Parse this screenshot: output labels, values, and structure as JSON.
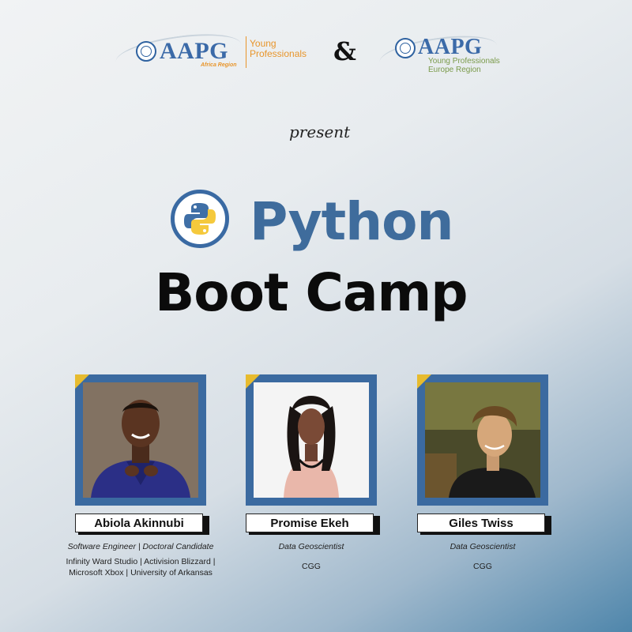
{
  "header": {
    "logo_left": {
      "brand": "AAPG",
      "region": "Africa Region",
      "program_line1": "Young",
      "program_line2": "Professionals"
    },
    "ampersand": "&",
    "logo_right": {
      "brand": "AAPG",
      "program_line1": "Young Professionals",
      "program_line2": "Europe Region"
    }
  },
  "present": "present",
  "title": {
    "line1": "Python",
    "line2": "Boot Camp"
  },
  "speakers": [
    {
      "name": "Abiola Akinnubi",
      "role": "Software Engineer | Doctoral Candidate",
      "org_lines": [
        "Infinity Ward Studio | Activision Blizzard |",
        "Microsoft Xbox | University of Arkansas"
      ]
    },
    {
      "name": "Promise Ekeh",
      "role": "Data Geoscientist",
      "org_lines": [
        "CGG"
      ]
    },
    {
      "name": "Giles Twiss",
      "role": "Data Geoscientist",
      "org_lines": [
        "CGG"
      ]
    }
  ],
  "colors": {
    "brand_blue": "#3b6aa0",
    "accent_yellow": "#e7bb2e",
    "orange": "#e8952b",
    "green": "#7a9a4a"
  }
}
